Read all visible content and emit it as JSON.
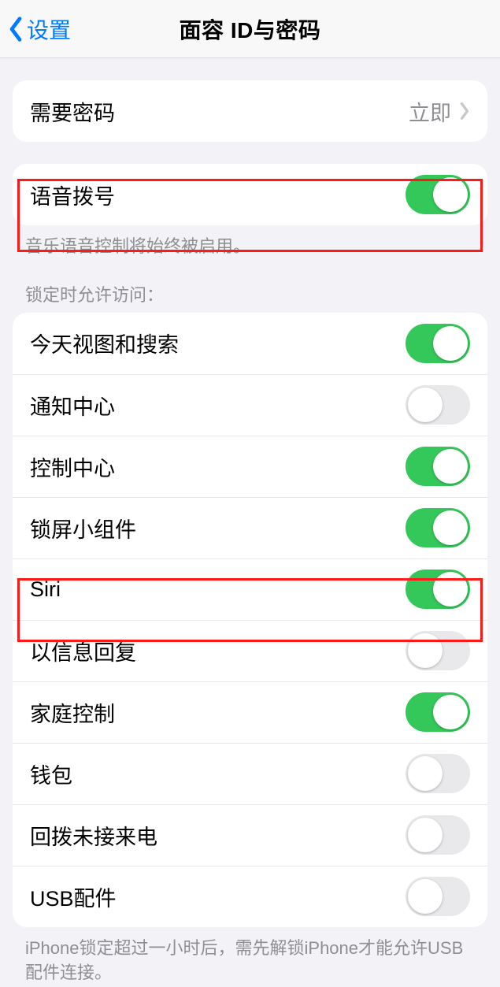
{
  "nav": {
    "back_label": "设置",
    "title": "面容 ID与密码"
  },
  "passcode_row": {
    "label": "需要密码",
    "value": "立即"
  },
  "voice_dial": {
    "label": "语音拨号",
    "on": true,
    "footer": "音乐语音控制将始终被启用。"
  },
  "lock_access_header": "锁定时允许访问：",
  "lock_items": [
    {
      "label": "今天视图和搜索",
      "on": true
    },
    {
      "label": "通知中心",
      "on": false
    },
    {
      "label": "控制中心",
      "on": true
    },
    {
      "label": "锁屏小组件",
      "on": true
    },
    {
      "label": "Siri",
      "on": true
    },
    {
      "label": "以信息回复",
      "on": false
    },
    {
      "label": "家庭控制",
      "on": true
    },
    {
      "label": "钱包",
      "on": false
    },
    {
      "label": "回拨未接来电",
      "on": false
    },
    {
      "label": "USB配件",
      "on": false
    }
  ],
  "usb_footer": "iPhone锁定超过一小时后，需先解锁iPhone才能允许USB配件连接。"
}
